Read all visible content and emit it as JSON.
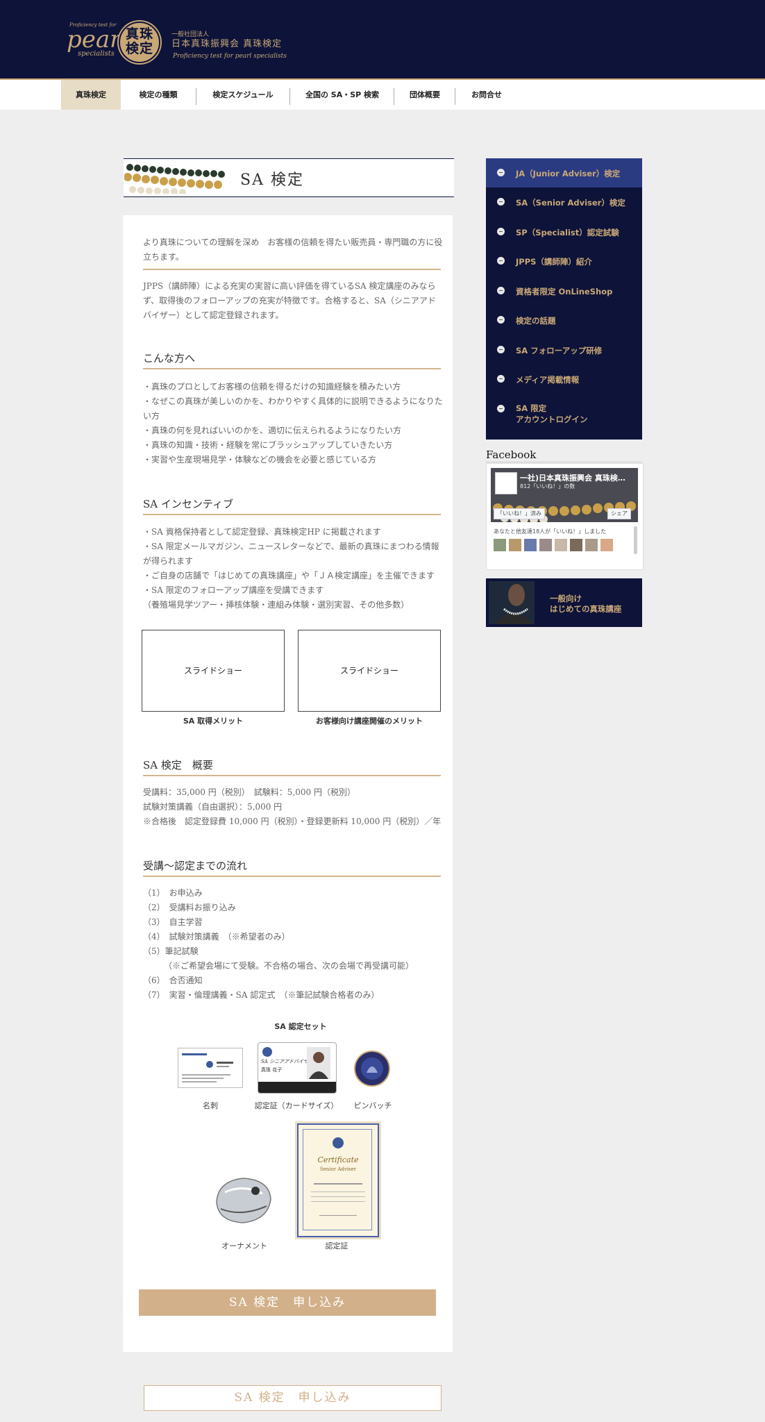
{
  "header": {
    "logo_tagline": "Proficiency test for",
    "logo_word": "pearl",
    "logo_sub": "specialists",
    "logo_mark": "真珠検定",
    "org_type": "一般社団法人",
    "org_name": "日本真珠振興会 真珠検定",
    "org_sub": "Proficiency test for pearl specialists"
  },
  "nav": {
    "items": [
      "真珠検定",
      "検定の種類",
      "検定スケジュール",
      "全国の SA・SP 検索",
      "団体概要",
      "お問合せ"
    ]
  },
  "page": {
    "title": "SA 検定",
    "intro": "より真珠についての理解を深め　お客様の信頼を得たい販売員・専門職の方に役立ちます。",
    "desc": "JPPS（講師陣）による充実の実習に高い評価を得ているSA 検定講座のみならず、取得後のフォローアップの充実が特徴です。合格すると、SA（シニアアドバイザー）として認定登録されます。",
    "target_heading": "こんな方へ",
    "target_items": [
      "・真珠のプロとしてお客様の信頼を得るだけの知識経験を積みたい方",
      "・なぜこの真珠が美しいのかを、わかりやすく具体的に説明できるようになりたい方",
      "・真珠の何を見ればいいのかを、適切に伝えられるようになりたい方",
      "・真珠の知識・技術・経験を常にブラッシュアップしていきたい方",
      "・実習や生産現場見学・体験などの機会を必要と感じている方"
    ],
    "incentive_heading": "SA インセンティブ",
    "incentive_items": [
      "・SA 資格保持者として認定登録、真珠検定HP に掲載されます",
      "・SA 限定メールマガジン、ニュースレターなどで、最新の真珠にまつわる情報が得られます",
      "・ご自身の店舗で「はじめての真珠講座」や「ＪＡ検定講座」を主催できます",
      "・SA 限定のフォローアップ講座を受講できます",
      "（養殖場見学ツアー・挿核体験・連組み体験・選別実習、その他多数）"
    ],
    "slides": [
      {
        "label": "スライドショー",
        "caption": "SA 取得メリット"
      },
      {
        "label": "スライドショー",
        "caption": "お客様向け講座開催のメリット"
      }
    ],
    "overview_heading": "SA 検定　概要",
    "overview_items": [
      "受講料：35,000 円（税別）　試験料：5,000 円（税別）",
      "試験対策講義（自由選択）：5,000 円",
      "※合格後　認定登録費 10,000 円（税別）・登録更新料 10,000 円（税別）／年"
    ],
    "flow_heading": "受講～認定までの流れ",
    "flow_items": [
      "（1）　お申込み",
      "（2）　受講料お振り込み",
      "（3）　自主学習",
      "（4）　試験対策講義　（※希望者のみ）",
      "（5）筆記試験",
      "　　　（※ご希望会場にて受験。不合格の場合、次の会場で再受講可能）",
      "（6）　合否通知",
      "（7）　実習・倫理講義・SA 認定式　（※筆記試験合格者のみ）"
    ],
    "set_heading": "SA 認定セット",
    "set_items": [
      "名刺",
      "認定証（カードサイズ）",
      "ピンバッチ",
      "オーナメント",
      "認定証"
    ],
    "cert_card_title": "SA シニアアドバイザー",
    "cert_card_name": "真珠 花子",
    "certificate_title": "Certificate",
    "certificate_sub": "Senior Adviser",
    "apply_label": "SA 検定　申し込み",
    "apply_outline_label": "SA 検定　申し込み"
  },
  "sidebar": {
    "menu": [
      "JA（Junior Adviser）検定",
      " SA（Senior Adviser）検定",
      "SP（Specialist）認定試験",
      "JPPS（講師陣）紹介",
      "資格者限定 OnLineShop",
      "検定の話題",
      " SA フォローアップ研修",
      "メディア掲載情報",
      "SA 限定\nアカウントログイン"
    ],
    "facebook_title": "Facebook",
    "fb_page_name": "一社)日本真珠振興会 真珠検…",
    "fb_likes_line": "812「いいね！」の数",
    "fb_like_btn": "「いいね！」済み",
    "fb_share_btn": "シェア",
    "fb_friends": "あなたと他友達18人が「いいね！」しました",
    "banner_line1": "一般向け",
    "banner_line2": "はじめての真珠講座"
  },
  "colors": {
    "navy": "#0d1339",
    "gold": "#c9a877",
    "accent_line": "#d2b48c",
    "active_menu": "#2a3b82"
  }
}
